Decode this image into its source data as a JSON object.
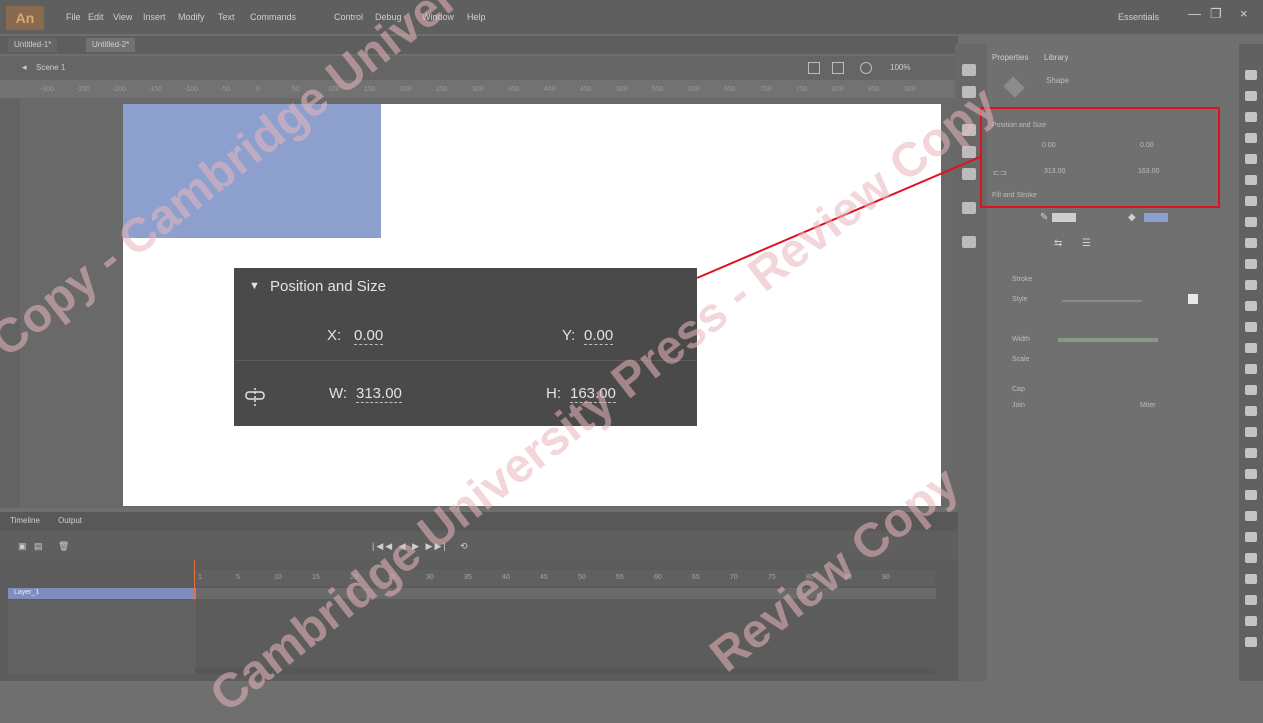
{
  "app": {
    "logo": "An",
    "menu": [
      "File",
      "Edit",
      "View",
      "Insert",
      "Modify",
      "Text",
      "Commands",
      "Control",
      "Debug",
      "Window",
      "Help"
    ],
    "workspace": "Essentials",
    "window_controls": [
      "—",
      "❐",
      "×"
    ]
  },
  "tabs": [
    "Untitled-1*",
    "Untitled-2*"
  ],
  "stage_bar": {
    "scene": "Scene 1",
    "zoom": "100%"
  },
  "ruler_ticks": [
    "-300",
    "-250",
    "-200",
    "-150",
    "-100",
    "-50",
    "0",
    "50",
    "100",
    "150",
    "200",
    "250",
    "300",
    "350",
    "400",
    "450",
    "500",
    "550",
    "600",
    "650",
    "700",
    "750",
    "800",
    "850",
    "900"
  ],
  "zoom_callout": {
    "section_title": "Position and Size",
    "x_label": "X:",
    "x_value": "0.00",
    "y_label": "Y:",
    "y_value": "0.00",
    "w_label": "W:",
    "w_value": "313.00",
    "h_label": "H:",
    "h_value": "163.00",
    "link_icon": "link-proportions-icon"
  },
  "properties_panel": {
    "tabs": [
      "Properties",
      "Library"
    ],
    "object_type": "Shape",
    "position_and_size": "Position and Size",
    "x": "0.00",
    "y": "0.00",
    "w": "313.00",
    "h": "163.00",
    "fill_and_stroke": "Fill and Stroke",
    "stroke_label": "Stroke",
    "style_label": "Style",
    "width_label": "Width",
    "scale_label": "Scale",
    "cap_label": "Cap",
    "join_label": "Join",
    "miter_label": "Miter",
    "fill_color": "#8d9fcd",
    "stroke_color": "#cfcfcf"
  },
  "timeline": {
    "tabs": [
      "Timeline",
      "Output"
    ],
    "layer_name": "Layer_1",
    "frame_numbers": [
      "1",
      "5",
      "10",
      "15",
      "20",
      "25",
      "30",
      "35",
      "40",
      "45",
      "50",
      "55",
      "60",
      "65",
      "70",
      "75",
      "80",
      "85",
      "90"
    ]
  },
  "watermark": [
    "Copy - Cambridge University Press - Review Copy",
    "Review Copy",
    "Cambridge University Press - Review Copy"
  ],
  "colors": {
    "callout_line": "#e01020",
    "layer_highlight": "#7e8dbd",
    "shape_fill": "#8d9fcd"
  }
}
